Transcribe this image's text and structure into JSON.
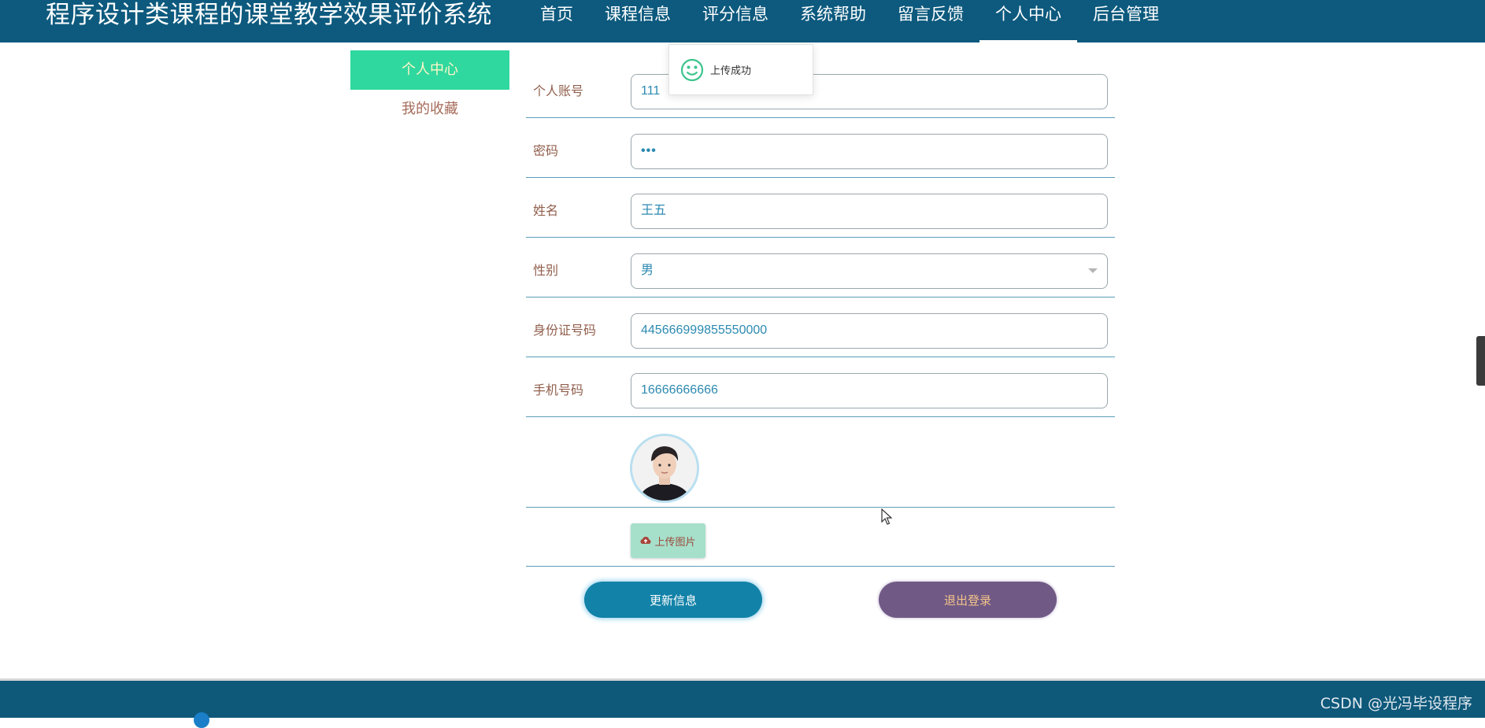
{
  "header": {
    "site_title": "程序设计类课程的课堂教学效果评价系统",
    "nav": [
      {
        "label": "首页",
        "active": false
      },
      {
        "label": "课程信息",
        "active": false
      },
      {
        "label": "评分信息",
        "active": false
      },
      {
        "label": "系统帮助",
        "active": false
      },
      {
        "label": "留言反馈",
        "active": false
      },
      {
        "label": "个人中心",
        "active": true
      },
      {
        "label": "后台管理",
        "active": false
      }
    ]
  },
  "sidebar": {
    "items": [
      {
        "label": "个人中心",
        "active": true
      },
      {
        "label": "我的收藏",
        "active": false
      }
    ]
  },
  "form": {
    "account": {
      "label": "个人账号",
      "value": "111"
    },
    "password": {
      "label": "密码",
      "value": "•••"
    },
    "name": {
      "label": "姓名",
      "value": "王五"
    },
    "gender": {
      "label": "性别",
      "value": "男"
    },
    "id_number": {
      "label": "身份证号码",
      "value": "445666999855550000"
    },
    "phone": {
      "label": "手机号码",
      "value": "16666666666"
    },
    "upload_label": "上传图片"
  },
  "actions": {
    "update_label": "更新信息",
    "logout_label": "退出登录"
  },
  "toast": {
    "message": "上传成功",
    "icon": "smile-icon"
  },
  "footer": {
    "watermark": "CSDN @光冯毕设程序"
  },
  "colors": {
    "header_bg": "#0d5a7e",
    "sidebar_active": "#2fd89e",
    "update_button": "#1282a8",
    "logout_button": "#705a85",
    "upload_button": "#a6e0cb"
  }
}
